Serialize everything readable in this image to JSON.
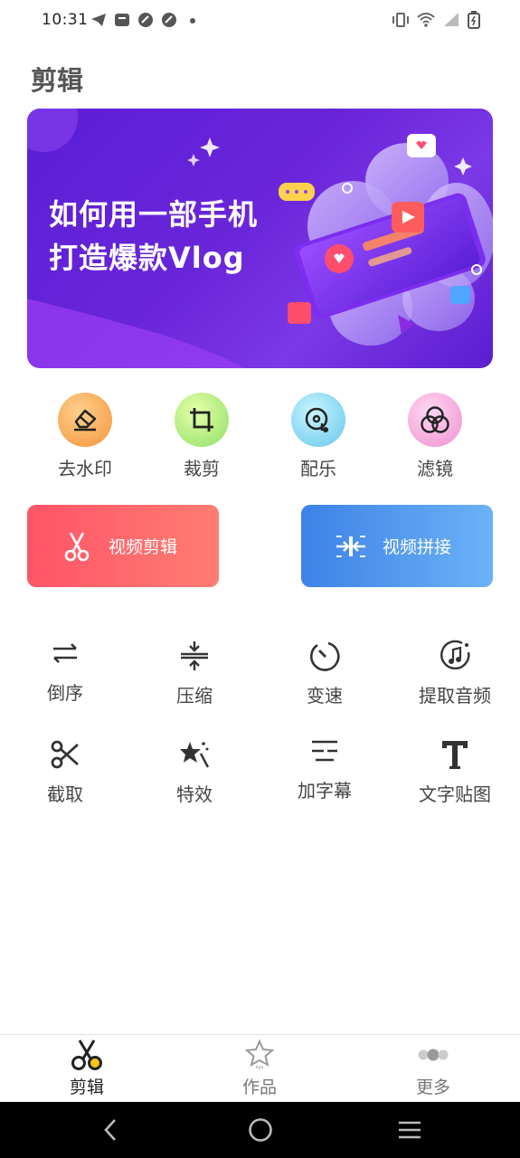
{
  "status_bar": {
    "time": "10:31",
    "icons_left": [
      "telegram-icon",
      "mail-icon",
      "app-icon",
      "app-icon",
      "dot-icon"
    ],
    "icons_right": [
      "vibrate-icon",
      "wifi-icon",
      "signal-icon",
      "battery-icon"
    ]
  },
  "page_title": "剪辑",
  "banner": {
    "line1": "如何用一部手机",
    "line2": "打造爆款Vlog"
  },
  "quick_tools": [
    {
      "label": "去水印",
      "icon": "eraser-icon",
      "color": "#f5a85a"
    },
    {
      "label": "裁剪",
      "icon": "crop-icon",
      "color": "#a6e57a"
    },
    {
      "label": "配乐",
      "icon": "music-disc-icon",
      "color": "#7fd3ee"
    },
    {
      "label": "滤镜",
      "icon": "filter-icon",
      "color": "#f4a6d8"
    }
  ],
  "big_buttons": {
    "edit": "视频剪辑",
    "join": "视频拼接"
  },
  "tools": [
    {
      "label": "倒序",
      "icon": "reverse-icon"
    },
    {
      "label": "压缩",
      "icon": "compress-icon"
    },
    {
      "label": "变速",
      "icon": "speed-icon"
    },
    {
      "label": "提取音频",
      "icon": "extract-audio-icon"
    },
    {
      "label": "截取",
      "icon": "cut-icon"
    },
    {
      "label": "特效",
      "icon": "effects-icon"
    },
    {
      "label": "加字幕",
      "icon": "subtitle-icon"
    },
    {
      "label": "文字贴图",
      "icon": "text-icon"
    }
  ],
  "bottom_nav": [
    {
      "label": "剪辑",
      "icon": "scissors-icon",
      "active": true
    },
    {
      "label": "作品",
      "icon": "star-icon",
      "active": false
    },
    {
      "label": "更多",
      "icon": "more-icon",
      "active": false
    }
  ],
  "colors": {
    "accent_red": "#ff5468",
    "accent_blue": "#3d82e6",
    "banner_purple": "#5a1fd6"
  }
}
